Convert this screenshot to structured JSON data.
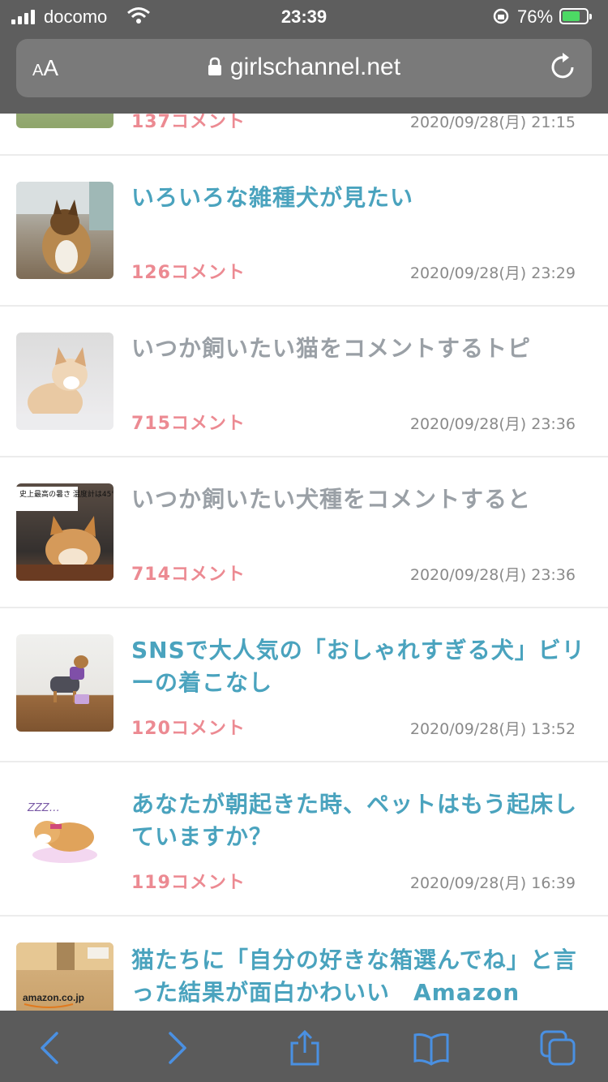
{
  "status": {
    "carrier": "docomo",
    "time": "23:39",
    "battery": "76%",
    "battery_level": 0.76
  },
  "urlbar": {
    "text_size_small": "A",
    "text_size_large": "A",
    "domain": "girlschannel.net"
  },
  "topics": [
    {
      "title": "",
      "count": "137コメント",
      "date": "2020/09/28(月) 21:15",
      "state": "unread",
      "thumb": "grass-photo"
    },
    {
      "title": "いろいろな雑種犬が見たい",
      "count": "126コメント",
      "date": "2020/09/28(月) 23:29",
      "state": "unread",
      "thumb": "sheltie-photo"
    },
    {
      "title": "いつか飼いたい猫をコメントするトピ",
      "count": "715コメント",
      "date": "2020/09/28(月) 23:36",
      "state": "read",
      "thumb": "kitten-photo"
    },
    {
      "title": "いつか飼いたい犬種をコメントすると",
      "count": "714コメント",
      "date": "2020/09/28(月) 23:36",
      "state": "read",
      "thumb": "shiba-photo",
      "thumb_caption": "史上最高の暑さ 温度計は45℃"
    },
    {
      "title": "SNSで大人気の「おしゃれすぎる犬」ビリーの着こなし",
      "count": "120コメント",
      "date": "2020/09/28(月) 13:52",
      "state": "unread",
      "thumb": "dressed-dog-photo"
    },
    {
      "title": "あなたが朝起きた時、ペットはもう起床していますか？",
      "count": "119コメント",
      "date": "2020/09/28(月) 16:39",
      "state": "unread",
      "thumb": "sleeping-dog-illustration",
      "thumb_caption": "ZZZ…"
    },
    {
      "title": "猫たちに「自分の好きな箱選んでね」と言った結果が面白かわいい　Amazon",
      "count": "",
      "date": "",
      "state": "unread",
      "thumb": "amazon-box-photo",
      "thumb_caption": "amazon.co.jp"
    }
  ],
  "colors": {
    "unread_title": "#4aa3be",
    "read_title": "#9aa0a6",
    "comment_count": "#ec8a92",
    "toolbar_icon": "#4a90e2"
  }
}
